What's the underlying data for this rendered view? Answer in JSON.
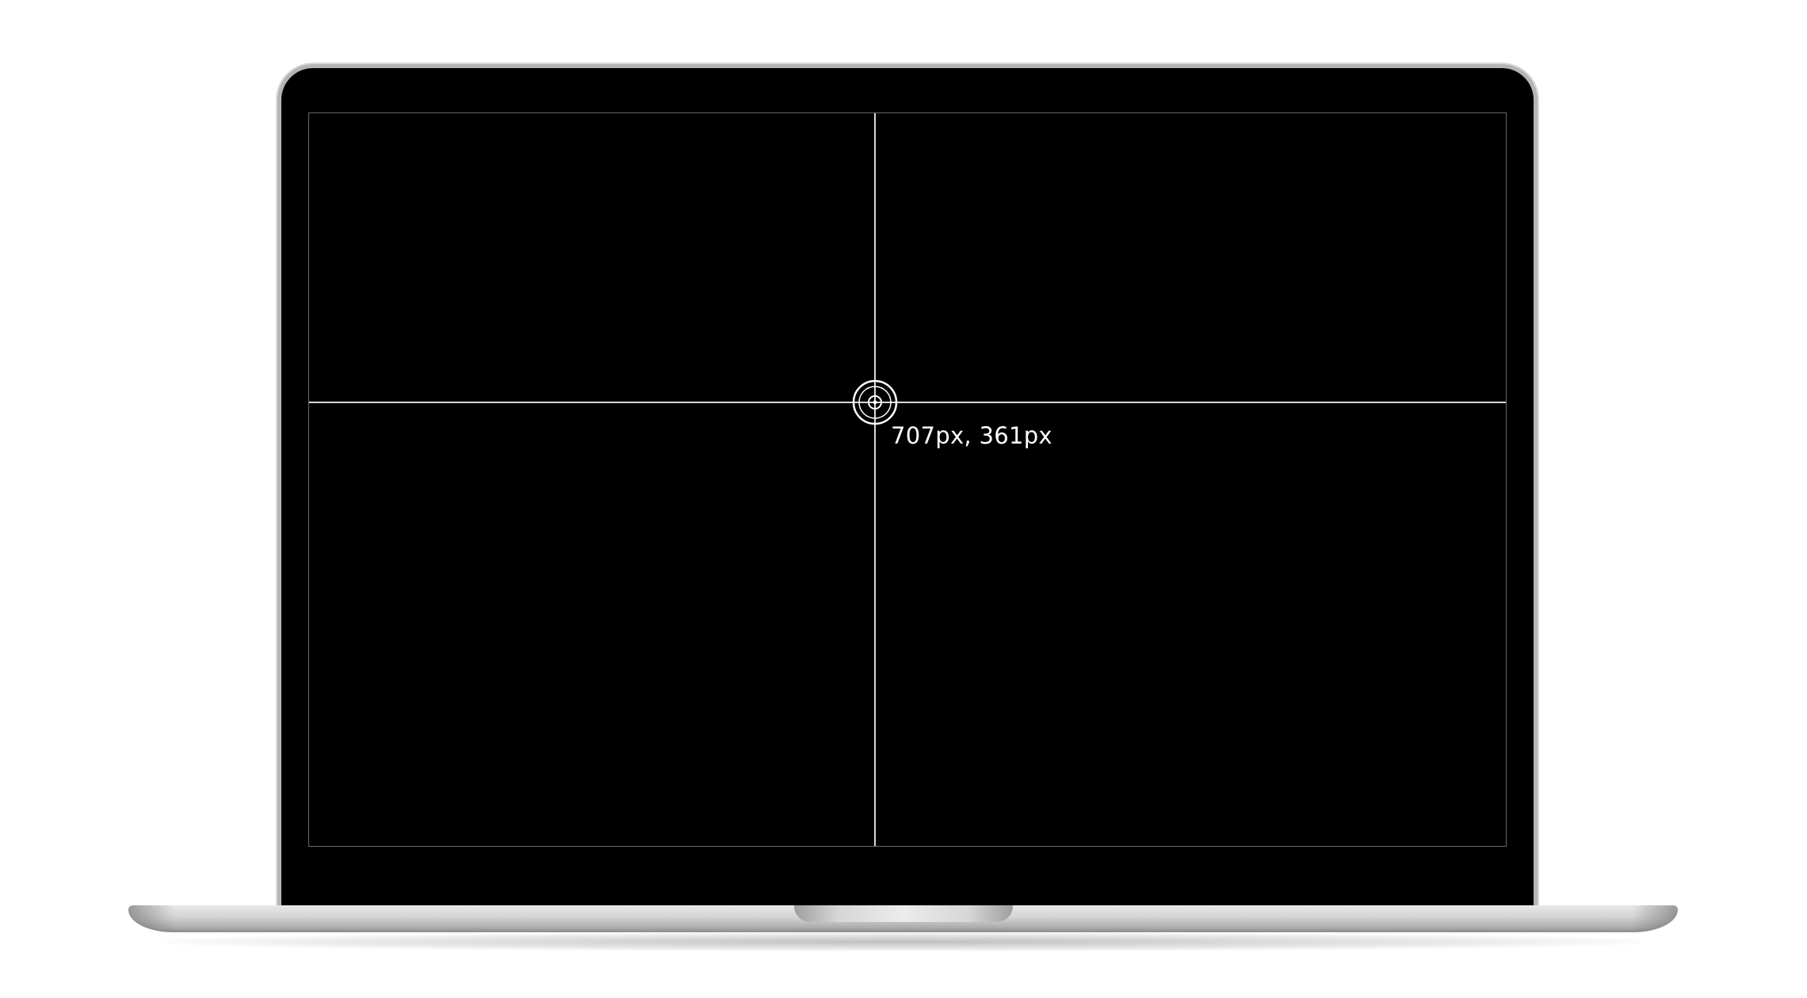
{
  "screen": {
    "background_color": "#000000",
    "crosshair_color": "#d8d8d8"
  },
  "cursor": {
    "icon": "crosshair-target-icon",
    "coordinates_label": "707px, 361px"
  },
  "device": {
    "type": "laptop",
    "lid_color": "#000000",
    "base_color": "#d3d3d3"
  }
}
